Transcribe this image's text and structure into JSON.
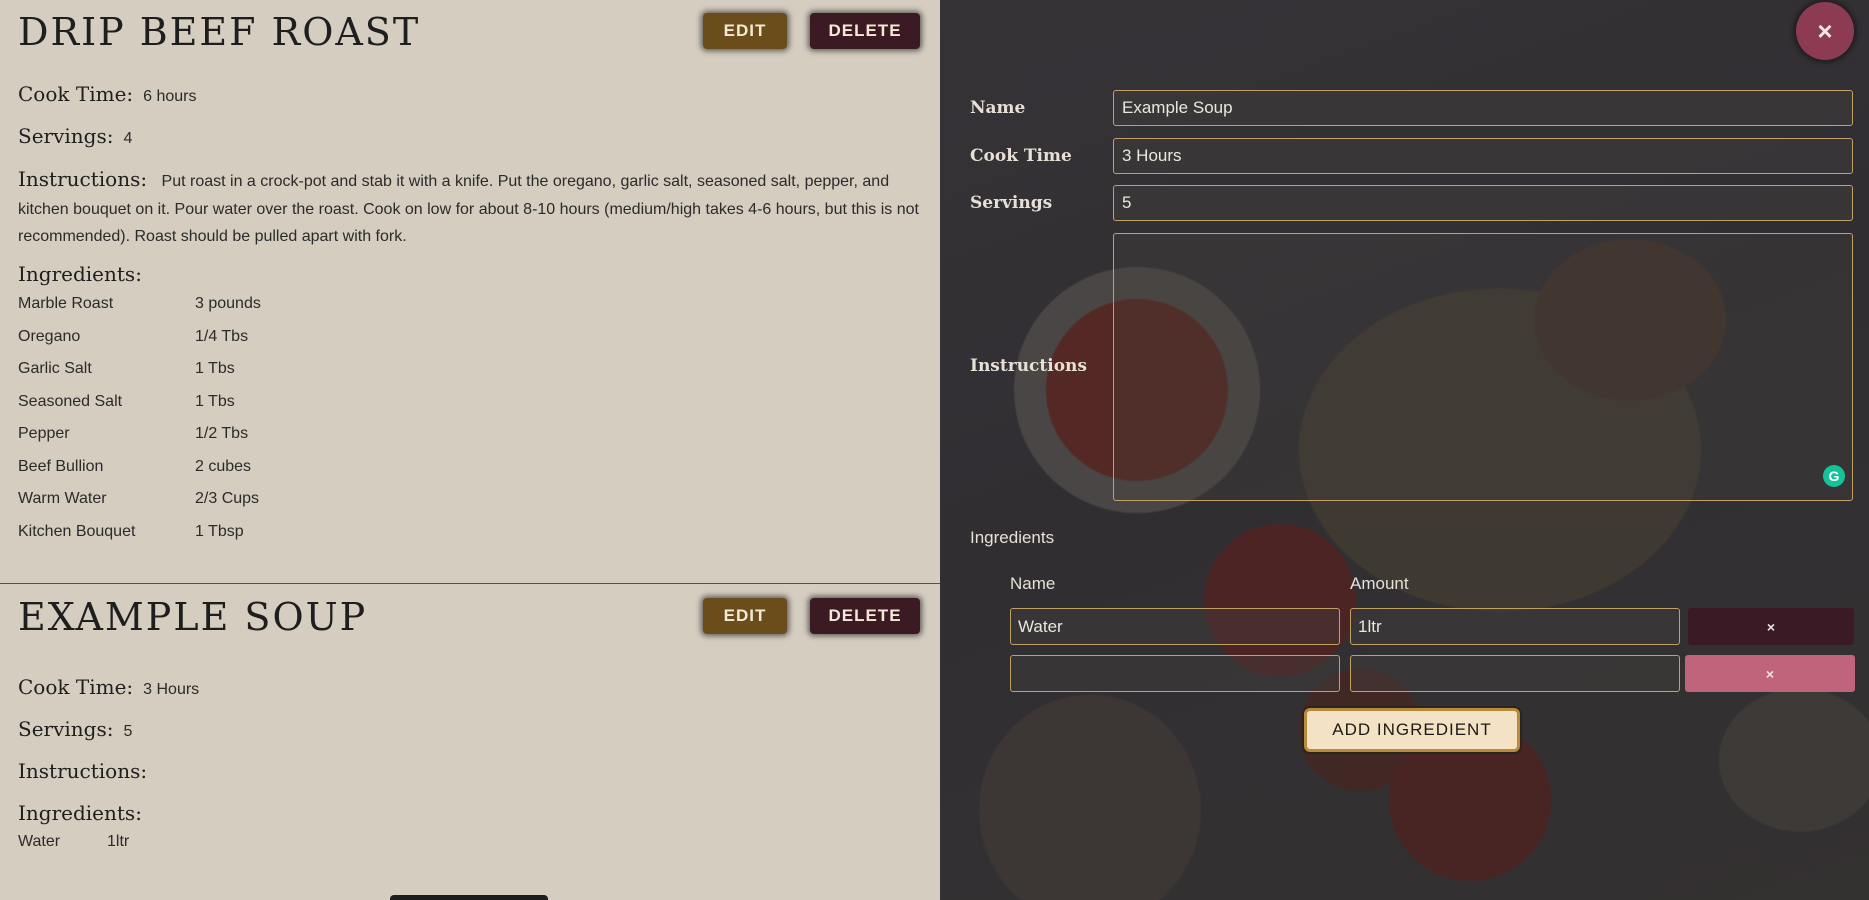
{
  "common": {
    "edit_label": "EDIT",
    "delete_label": "DELETE",
    "cook_time_label": "Cook Time:",
    "servings_label": "Servings:",
    "instructions_label": "Instructions:",
    "ingredients_label": "Ingredients:"
  },
  "recipes": [
    {
      "title": "DRIP BEEF ROAST",
      "cook_time": "6 hours",
      "servings": "4",
      "instructions": "Put roast in a crock-pot and stab it with a knife. Put the oregano, garlic salt, seasoned salt, pepper, and kitchen bouquet on it. Pour water over the roast. Cook on low for about 8-10 hours (medium/high takes 4-6 hours, but this is not recommended). Roast should be pulled apart with fork.",
      "ingredients": [
        {
          "name": "Marble Roast",
          "amount": "3 pounds"
        },
        {
          "name": "Oregano",
          "amount": "1/4 Tbs"
        },
        {
          "name": "Garlic Salt",
          "amount": "1 Tbs"
        },
        {
          "name": "Seasoned Salt",
          "amount": "1 Tbs"
        },
        {
          "name": "Pepper",
          "amount": "1/2 Tbs"
        },
        {
          "name": "Beef Bullion",
          "amount": "2 cubes"
        },
        {
          "name": "Warm Water",
          "amount": "2/3 Cups"
        },
        {
          "name": "Kitchen Bouquet",
          "amount": "1 Tbsp"
        }
      ]
    },
    {
      "title": "EXAMPLE SOUP",
      "cook_time": "3 Hours",
      "servings": "5",
      "instructions": "",
      "ingredients": [
        {
          "name": "Water",
          "amount": "1ltr"
        }
      ]
    }
  ],
  "form": {
    "close_glyph": "×",
    "name_label": "Name",
    "name_value": "Example Soup",
    "cook_time_label": "Cook Time",
    "cook_time_value": "3 Hours",
    "servings_label": "Servings",
    "servings_value": "5",
    "instructions_label": "Instructions",
    "instructions_value": "",
    "grammarly_glyph": "G",
    "ingredients_label": "Ingredients",
    "col_name_label": "Name",
    "col_amount_label": "Amount",
    "rows": [
      {
        "name": "Water",
        "amount": "1ltr",
        "remove_glyph": "×"
      },
      {
        "name": "",
        "amount": "",
        "remove_glyph": "×"
      }
    ],
    "add_label": "ADD INGREDIENT"
  },
  "colors": {
    "list_bg": "#d4cdc0",
    "edit_button": "#6b4d1c",
    "delete_button": "#3b1a24",
    "close_button": "#8c3b52",
    "input_border": "#c2a068",
    "remove_pink": "#c0647c",
    "add_button_bg": "#f3e2c6"
  }
}
